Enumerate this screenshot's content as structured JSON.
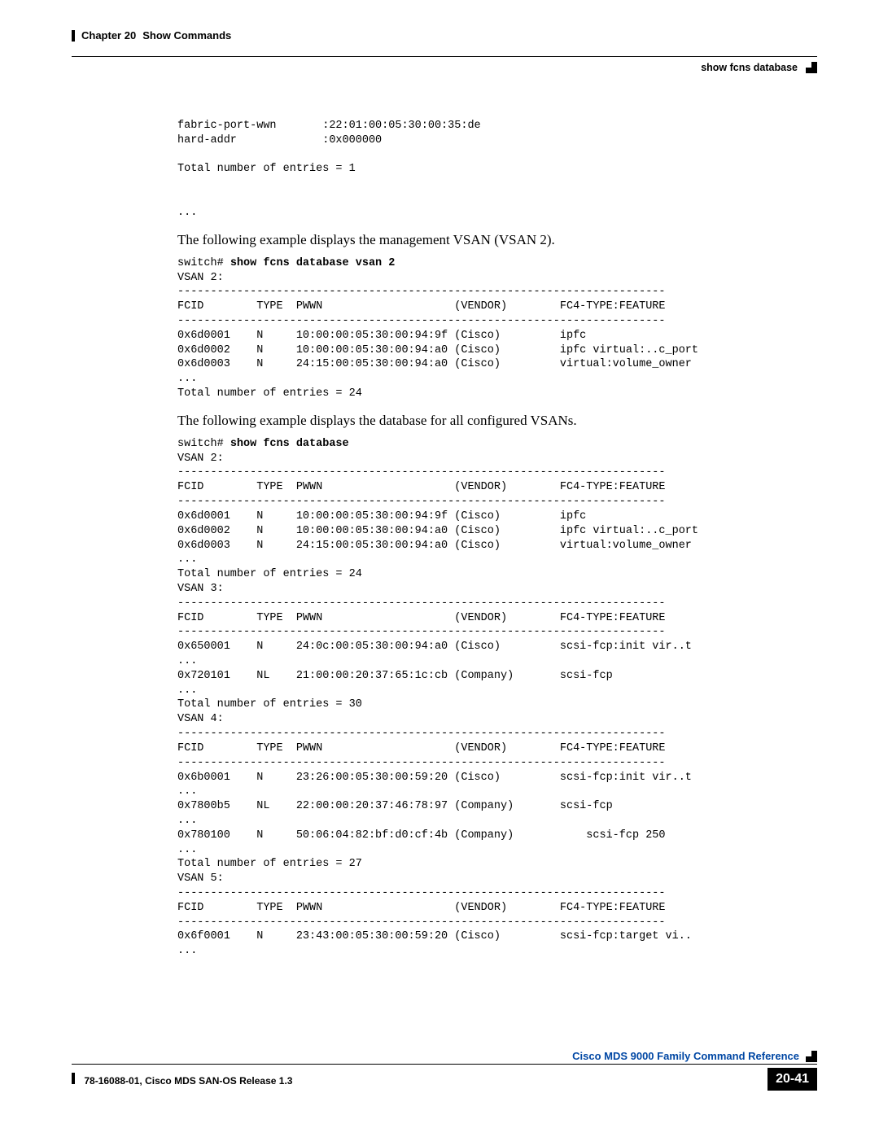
{
  "header": {
    "chapter": "Chapter 20",
    "chapter_title": "Show Commands",
    "section": "show fcns database"
  },
  "blocks": {
    "pre1": "fabric-port-wwn       :22:01:00:05:30:00:35:de\nhard-addr             :0x000000\n\nTotal number of entries = 1\n\n\n...",
    "body1": "The following example displays the management VSAN (VSAN 2).",
    "cmd2_prefix": "switch# ",
    "cmd2_bold": "show fcns database vsan 2",
    "pre2": "VSAN 2:\n--------------------------------------------------------------------------\nFCID        TYPE  PWWN                    (VENDOR)        FC4-TYPE:FEATURE\n--------------------------------------------------------------------------\n0x6d0001    N     10:00:00:05:30:00:94:9f (Cisco)         ipfc \n0x6d0002    N     10:00:00:05:30:00:94:a0 (Cisco)         ipfc virtual:..c_port\n0x6d0003    N     24:15:00:05:30:00:94:a0 (Cisco)         virtual:volume_owner\n...\nTotal number of entries = 24",
    "body2": "The following example displays the database for all configured VSANs.",
    "cmd3_prefix": "switch# ",
    "cmd3_bold": "show fcns database",
    "pre3": "VSAN 2:\n--------------------------------------------------------------------------\nFCID        TYPE  PWWN                    (VENDOR)        FC4-TYPE:FEATURE\n--------------------------------------------------------------------------\n0x6d0001    N     10:00:00:05:30:00:94:9f (Cisco)         ipfc \n0x6d0002    N     10:00:00:05:30:00:94:a0 (Cisco)         ipfc virtual:..c_port\n0x6d0003    N     24:15:00:05:30:00:94:a0 (Cisco)         virtual:volume_owner\n...\nTotal number of entries = 24\nVSAN 3:\n--------------------------------------------------------------------------\nFCID        TYPE  PWWN                    (VENDOR)        FC4-TYPE:FEATURE\n--------------------------------------------------------------------------\n0x650001    N     24:0c:00:05:30:00:94:a0 (Cisco)         scsi-fcp:init vir..t\n...\n0x720101    NL    21:00:00:20:37:65:1c:cb (Company)       scsi-fcp \n...\nTotal number of entries = 30\nVSAN 4:\n--------------------------------------------------------------------------\nFCID        TYPE  PWWN                    (VENDOR)        FC4-TYPE:FEATURE\n--------------------------------------------------------------------------\n0x6b0001    N     23:26:00:05:30:00:59:20 (Cisco)         scsi-fcp:init vir..t\n...\n0x7800b5    NL    22:00:00:20:37:46:78:97 (Company)       scsi-fcp \n...\n0x780100    N     50:06:04:82:bf:d0:cf:4b (Company)           scsi-fcp 250\n...\nTotal number of entries = 27\nVSAN 5:\n--------------------------------------------------------------------------\nFCID        TYPE  PWWN                    (VENDOR)        FC4-TYPE:FEATURE\n--------------------------------------------------------------------------\n0x6f0001    N     23:43:00:05:30:00:59:20 (Cisco)         scsi-fcp:target vi..\n..."
  },
  "footer": {
    "doc_title": "Cisco MDS 9000 Family Command Reference",
    "release": "78-16088-01, Cisco MDS SAN-OS Release 1.3",
    "page_num": "20-41"
  }
}
